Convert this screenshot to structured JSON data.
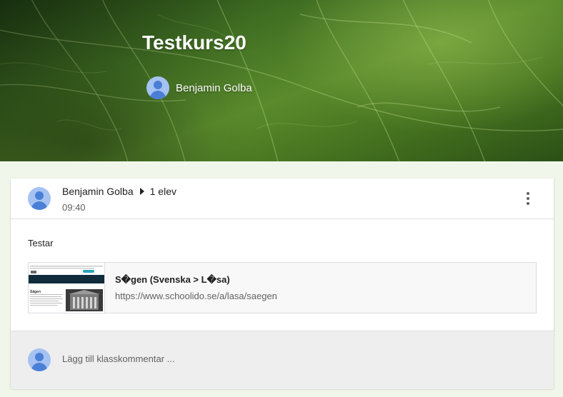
{
  "course": {
    "title": "Testkurs20",
    "teacher": "Benjamin Golba"
  },
  "post": {
    "author": "Benjamin Golba",
    "audience": "1 elev",
    "time": "09:40",
    "text": "Testar",
    "attachment": {
      "title": "S�gen (Svenska > L�sa)",
      "url": "https://www.schoolido.se/a/lasa/saegen",
      "thumb_heading": "Sägen"
    }
  },
  "comment": {
    "placeholder": "Lägg till klasskommentar ..."
  },
  "colors": {
    "banner_green": "#4f7f27",
    "avatar_bg": "#a5c2f2",
    "avatar_fg": "#4a7fd6",
    "page_bg": "#f1f6ea"
  },
  "icons": [
    "user-avatar-icon",
    "arrow-right-icon",
    "more-vert-icon"
  ]
}
